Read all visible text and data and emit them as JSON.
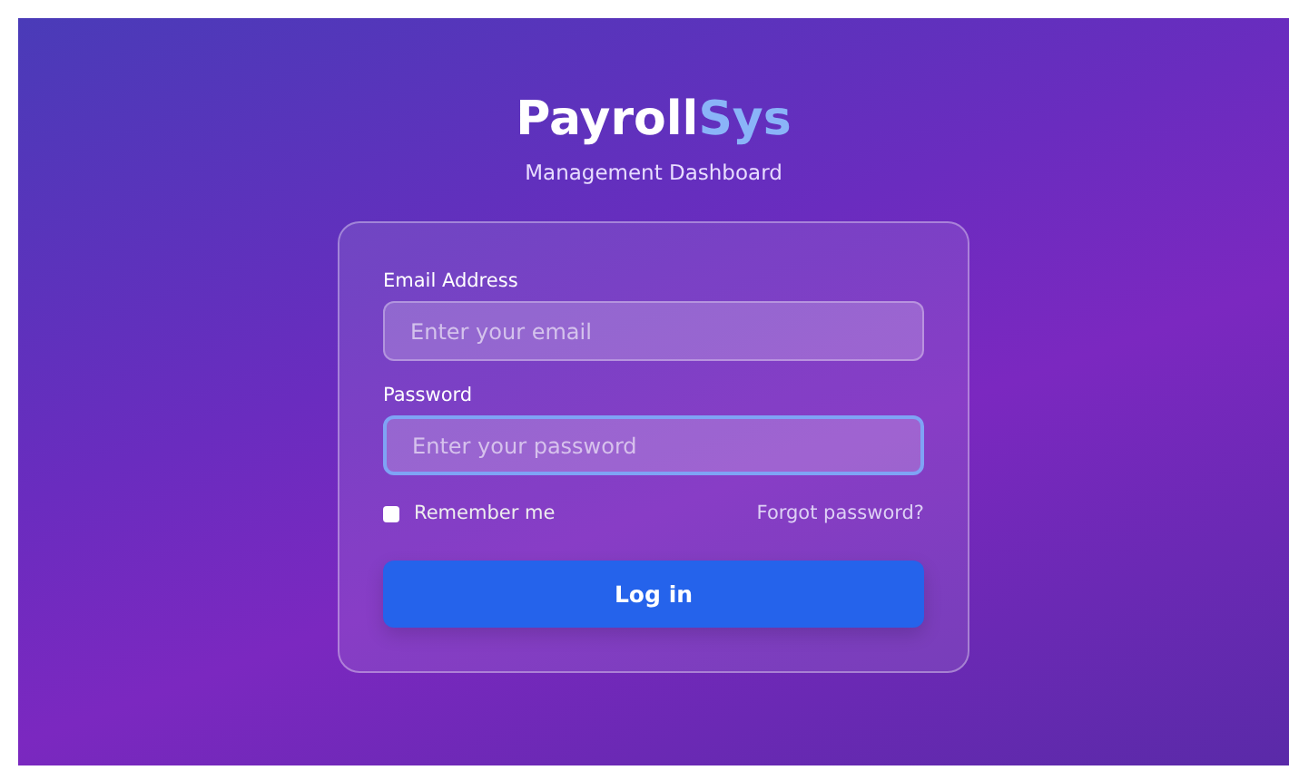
{
  "brand": {
    "title": "Payroll**Sys**",
    "subtitle": "Management Dashboard"
  },
  "fields": [
    {
      "label": "Email Address",
      "placeholder": "Enter your email",
      "focused": false
    },
    {
      "label": "Password",
      "placeholder": "Enter your password",
      "focused": true
    }
  ],
  "remember": {
    "label": "Remember me",
    "checked": false
  },
  "forgot_link": "Forgot password?",
  "submit": "Log in"
}
